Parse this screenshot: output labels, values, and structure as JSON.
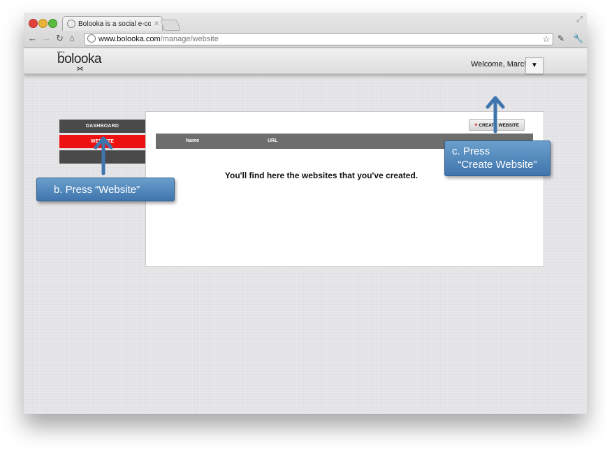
{
  "browser": {
    "tab_title": "Bolooka is a social e-commerce",
    "tab_close": "✕",
    "url_host": "www.bolooka.com",
    "url_path": "/manage/website"
  },
  "site": {
    "logo_beta": "BETA",
    "logo_text": "bolooka",
    "welcome": "Welcome, Marc!",
    "user_menu_icon": "▼"
  },
  "sidebar": {
    "items": [
      {
        "label": "DASHBOARD",
        "active": false
      },
      {
        "label": "WEBSITE",
        "active": true
      },
      {
        "label": "",
        "active": false
      }
    ]
  },
  "panel": {
    "create_button": "CREATE WEBSITE",
    "columns": [
      "Name",
      "URL"
    ],
    "empty_message": "You'll find here the websites that you've created."
  },
  "annotations": {
    "step_b": "b. Press “Website”",
    "step_c": "c. Press\n  “Create Website”"
  },
  "colors": {
    "accent_red": "#ee1111",
    "nav_dark": "#4a4a4a",
    "callout_blue": "#4f86bd"
  }
}
